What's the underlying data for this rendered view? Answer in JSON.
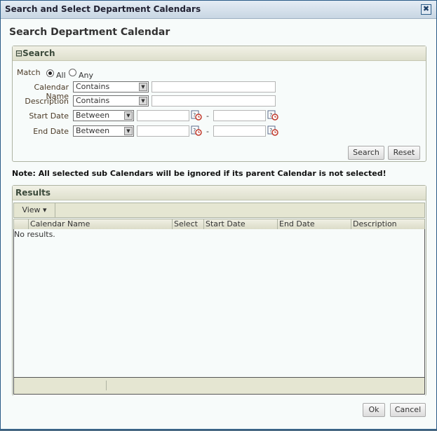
{
  "dialog": {
    "title": "Search and Select Department Calendars",
    "close_label": "✖"
  },
  "page_title": "Search Department Calendar",
  "search": {
    "header": "Search",
    "collapse_glyph": "⊟",
    "match_label": "Match",
    "match_options": [
      {
        "label": "All",
        "selected": true
      },
      {
        "label": "Any",
        "selected": false
      }
    ],
    "fields": [
      {
        "label": "Calendar Name",
        "operator": "Contains",
        "value": ""
      },
      {
        "label": "Description",
        "operator": "Contains",
        "value": ""
      },
      {
        "label": "Start Date",
        "operator": "Between",
        "from": "",
        "to": ""
      },
      {
        "label": "End Date",
        "operator": "Between",
        "from": "",
        "to": ""
      }
    ],
    "range_separator": "-",
    "search_button": "Search",
    "reset_button": "Reset"
  },
  "note": "Note: All selected sub Calendars will be ignored if its parent Calendar is not selected!",
  "results": {
    "header": "Results",
    "view_menu": "View ▾",
    "columns": [
      "Calendar Name",
      "Select",
      "Start Date",
      "End Date",
      "Description"
    ],
    "empty_text": "No results."
  },
  "footer": {
    "ok_button": "Ok",
    "cancel_button": "Cancel"
  }
}
